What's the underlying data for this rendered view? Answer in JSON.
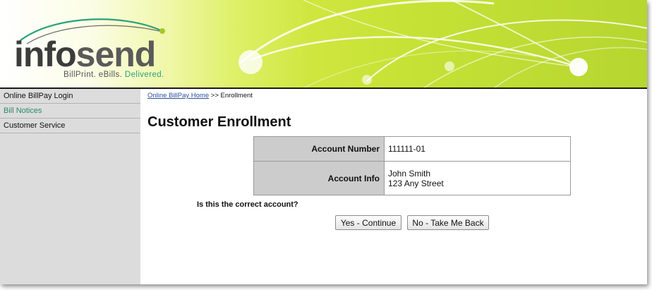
{
  "brand": {
    "logo_word_part1": "info",
    "logo_word_part2": "send",
    "tagline_part1": "BillPrint. eBills.",
    "tagline_part2": "Delivered.",
    "accent_color": "#2aa07c"
  },
  "sidebar": {
    "items": [
      {
        "label": "Online BillPay Login"
      },
      {
        "label": "Bill Notices"
      },
      {
        "label": "Customer Service"
      }
    ]
  },
  "breadcrumb": {
    "home_link": "Online BillPay Home",
    "separator": ">>",
    "current": "Enrollment"
  },
  "page": {
    "title": "Customer Enrollment"
  },
  "account": {
    "number_label": "Account Number",
    "number_value": "111111-01",
    "info_label": "Account Info",
    "info_name": "John Smith",
    "info_address": "123 Any Street"
  },
  "confirm": {
    "question": "Is this the correct account?",
    "yes_button": "Yes - Continue",
    "no_button": "No - Take Me Back"
  }
}
